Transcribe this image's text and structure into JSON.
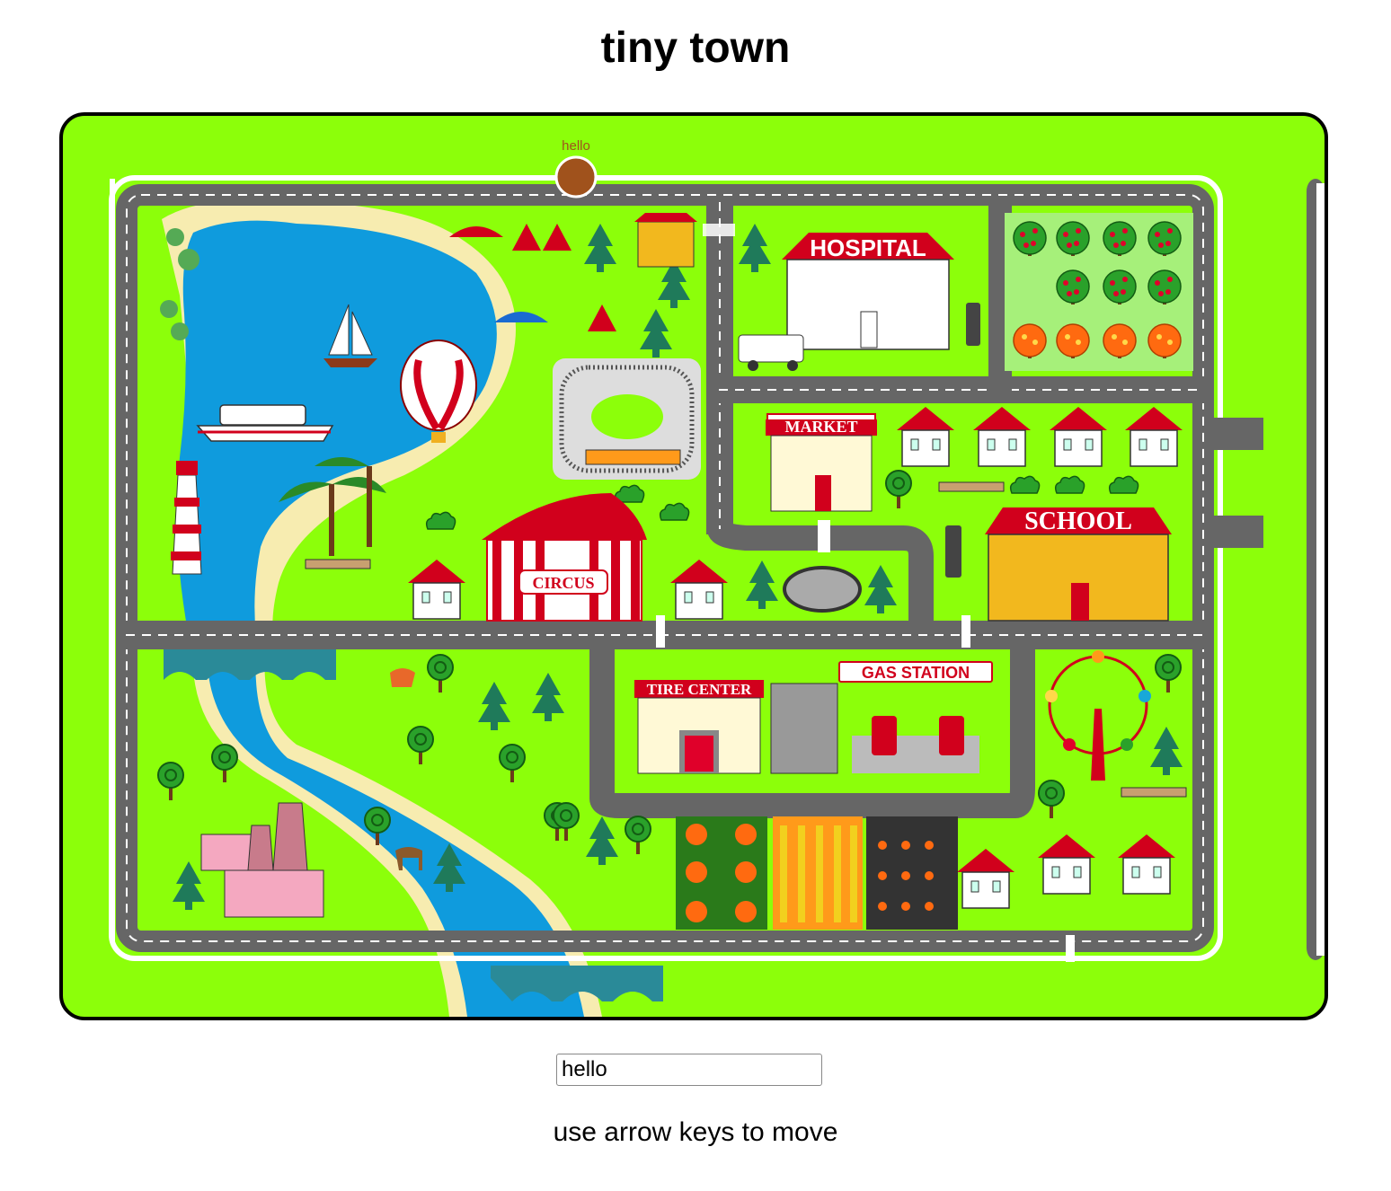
{
  "page": {
    "title": "tiny town",
    "hint": "use arrow keys to move"
  },
  "player": {
    "name": "hello",
    "color": "#a0521c"
  },
  "input": {
    "value": "hello"
  },
  "signs": {
    "hospital": "HOSPITAL",
    "market": "MARKET",
    "school": "SCHOOL",
    "circus": "CIRCUS",
    "tire_center": "TIRE CENTER",
    "gas_station": "GAS STATION"
  },
  "colors": {
    "grass": "#8cff0a",
    "road": "#666666",
    "water": "#0f9bdd",
    "sand": "#f7ecb0",
    "accent_red": "#d1001c"
  }
}
